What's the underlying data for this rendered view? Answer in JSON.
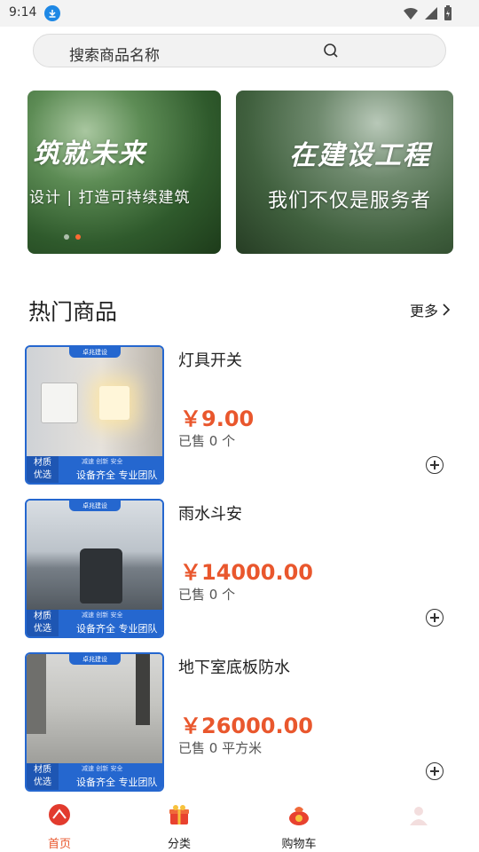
{
  "status_bar": {
    "time": "9:14"
  },
  "search": {
    "placeholder": "搜索商品名称"
  },
  "banners": [
    {
      "headline": "筑就未来",
      "subline": "设计 | 打造可持续建筑"
    },
    {
      "headline": "在建设工程",
      "subline": "我们不仅是服务者"
    }
  ],
  "section": {
    "title": "热门商品",
    "more_label": "更多"
  },
  "thumb_tag": "卓兆建设",
  "thumb_badge": [
    "材质",
    "优选"
  ],
  "thumb_small": "减速 创新 安全",
  "thumb_slogan": "设备齐全 专业团队",
  "products": [
    {
      "name": "灯具开关",
      "price": "￥9.00",
      "sold": "已售 0 个"
    },
    {
      "name": "雨水斗安",
      "price": "￥14000.00",
      "sold": "已售 0 个"
    },
    {
      "name": "地下室底板防水",
      "price": "￥26000.00",
      "sold": "已售 0 平方米"
    }
  ],
  "tabs": [
    {
      "label": "首页",
      "icon": "home-icon",
      "active": true
    },
    {
      "label": "分类",
      "icon": "gift-box-icon",
      "active": false
    },
    {
      "label": "购物车",
      "icon": "money-bag-icon",
      "active": false
    },
    {
      "label": "",
      "icon": "profile-icon",
      "active": false
    }
  ],
  "colors": {
    "accent": "#e9572d",
    "thumb_blue": "#2567cf"
  }
}
